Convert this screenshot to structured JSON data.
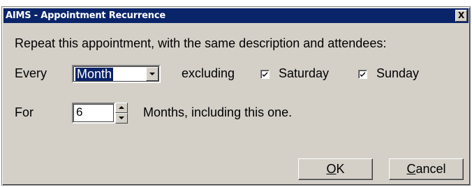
{
  "window": {
    "title": "AIMS - Appointment Recurrence",
    "close_glyph": "X"
  },
  "form": {
    "intro_text": "Repeat this appointment, with the same description and attendees:",
    "every_label": "Every",
    "frequency_selected": "Month",
    "excluding_label": "excluding",
    "saturday_label": "Saturday",
    "saturday_checked": true,
    "sunday_label": "Sunday",
    "sunday_checked": true,
    "for_label": "For",
    "count_value": "6",
    "count_suffix": "Months, including this one."
  },
  "buttons": {
    "ok_mnemonic": "O",
    "ok_rest": "K",
    "cancel_mnemonic": "C",
    "cancel_rest": "ancel"
  },
  "colors": {
    "titlebar": "#0a246a",
    "face": "#d4d0c8",
    "selection": "#0a246a"
  },
  "icons": {
    "close": "close-icon",
    "dropdown": "chevron-down-icon",
    "spin_up": "spin-up-icon",
    "spin_down": "spin-down-icon",
    "check": "checkmark-icon"
  }
}
